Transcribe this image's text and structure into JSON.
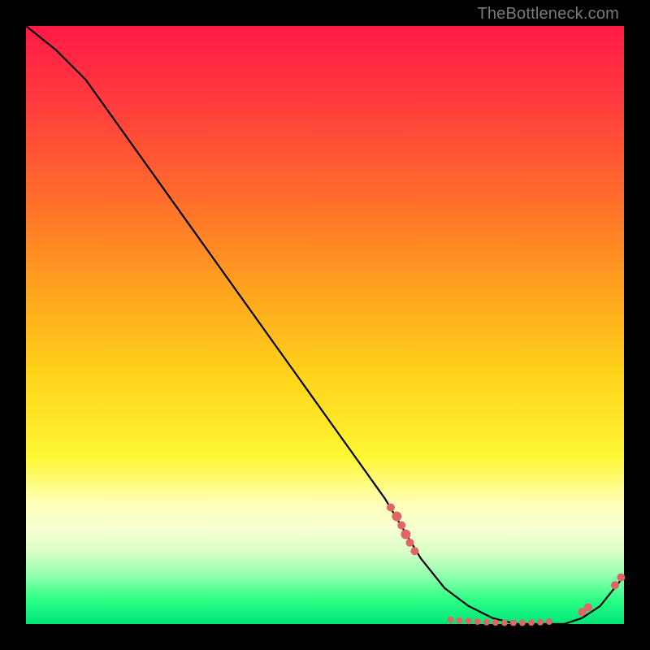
{
  "watermark": "TheBottleneck.com",
  "chart_data": {
    "type": "line",
    "title": "",
    "xlabel": "",
    "ylabel": "",
    "xlim": [
      0,
      100
    ],
    "ylim": [
      0,
      100
    ],
    "grid": false,
    "legend": false,
    "series": [
      {
        "name": "curve",
        "x": [
          0,
          5,
          10,
          15,
          20,
          25,
          30,
          35,
          40,
          45,
          50,
          55,
          60,
          63,
          66,
          70,
          74,
          78,
          82,
          86,
          90,
          93,
          96,
          100
        ],
        "y": [
          100,
          96,
          91,
          84,
          77,
          70,
          63,
          56,
          49,
          42,
          35,
          28,
          21,
          16,
          11,
          6,
          3,
          1,
          0,
          0,
          0,
          1,
          3,
          8
        ]
      }
    ],
    "markers": [
      {
        "x": 61.0,
        "y": 19.5,
        "r": 5
      },
      {
        "x": 62.0,
        "y": 18.0,
        "r": 6
      },
      {
        "x": 62.8,
        "y": 16.5,
        "r": 5
      },
      {
        "x": 63.5,
        "y": 15.0,
        "r": 6
      },
      {
        "x": 64.2,
        "y": 13.6,
        "r": 5
      },
      {
        "x": 65.0,
        "y": 12.2,
        "r": 5
      },
      {
        "x": 71.0,
        "y": 0.7,
        "r": 4
      },
      {
        "x": 72.5,
        "y": 0.6,
        "r": 4
      },
      {
        "x": 74.0,
        "y": 0.5,
        "r": 4
      },
      {
        "x": 75.5,
        "y": 0.4,
        "r": 4
      },
      {
        "x": 77.0,
        "y": 0.3,
        "r": 4
      },
      {
        "x": 78.5,
        "y": 0.25,
        "r": 4
      },
      {
        "x": 80.0,
        "y": 0.2,
        "r": 4
      },
      {
        "x": 81.5,
        "y": 0.2,
        "r": 4
      },
      {
        "x": 83.0,
        "y": 0.2,
        "r": 4
      },
      {
        "x": 84.5,
        "y": 0.25,
        "r": 4
      },
      {
        "x": 86.0,
        "y": 0.3,
        "r": 4
      },
      {
        "x": 87.5,
        "y": 0.4,
        "r": 4
      },
      {
        "x": 93.0,
        "y": 2.0,
        "r": 5
      },
      {
        "x": 94.0,
        "y": 2.8,
        "r": 5
      },
      {
        "x": 98.5,
        "y": 6.5,
        "r": 5
      },
      {
        "x": 99.5,
        "y": 7.8,
        "r": 5
      }
    ],
    "colors": {
      "line": "#000000",
      "marker": "#e06666"
    }
  }
}
